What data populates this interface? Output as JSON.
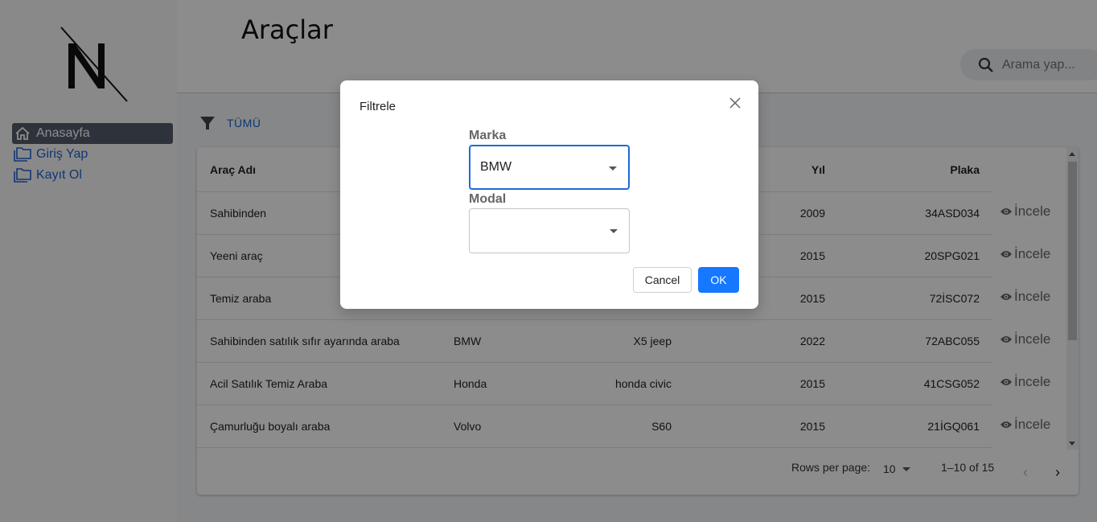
{
  "sidebar": {
    "items": [
      {
        "label": "Anasayfa",
        "icon": "home-icon"
      },
      {
        "label": "Giriş Yap",
        "icon": "folder-icon"
      },
      {
        "label": "Kayıt Ol",
        "icon": "folder-icon"
      }
    ]
  },
  "header": {
    "title": "Araçlar",
    "search_placeholder": "Arama yap..."
  },
  "filter_bar": {
    "all_label": "TÜMÜ"
  },
  "table": {
    "columns": {
      "name": "Araç Adı",
      "year": "Yıl",
      "plate": "Plaka"
    },
    "inspect_label": "İncele",
    "rows": [
      {
        "name": "Sahibinden",
        "brand": "",
        "model": "",
        "year": "2009",
        "plate": "34ASD034"
      },
      {
        "name": "Yeeni araç",
        "brand": "",
        "model": "",
        "year": "2015",
        "plate": "20SPG021"
      },
      {
        "name": "Temiz araba",
        "brand": "",
        "model": "",
        "year": "2015",
        "plate": "72İSC072"
      },
      {
        "name": "Sahibinden satılık sıfır ayarında araba",
        "brand": "BMW",
        "model": "X5 jeep",
        "year": "2022",
        "plate": "72ABC055"
      },
      {
        "name": "Acil Satılık Temiz Araba",
        "brand": "Honda",
        "model": "honda civic",
        "year": "2015",
        "plate": "41CSG052"
      },
      {
        "name": "Çamurluğu boyalı araba",
        "brand": "Volvo",
        "model": "S60",
        "year": "2015",
        "plate": "21İGQ061"
      }
    ]
  },
  "pagination": {
    "rows_per_page_label": "Rows per page:",
    "rows_per_page_value": "10",
    "range_text": "1–10 of 15"
  },
  "modal": {
    "title": "Filtrele",
    "brand_label": "Marka",
    "brand_value": "BMW",
    "model_label": "Modal",
    "model_value": "",
    "cancel_label": "Cancel",
    "ok_label": "OK"
  },
  "colors": {
    "accent": "#1677ff",
    "link": "#1e63d6",
    "active_nav": "#555e6c"
  }
}
